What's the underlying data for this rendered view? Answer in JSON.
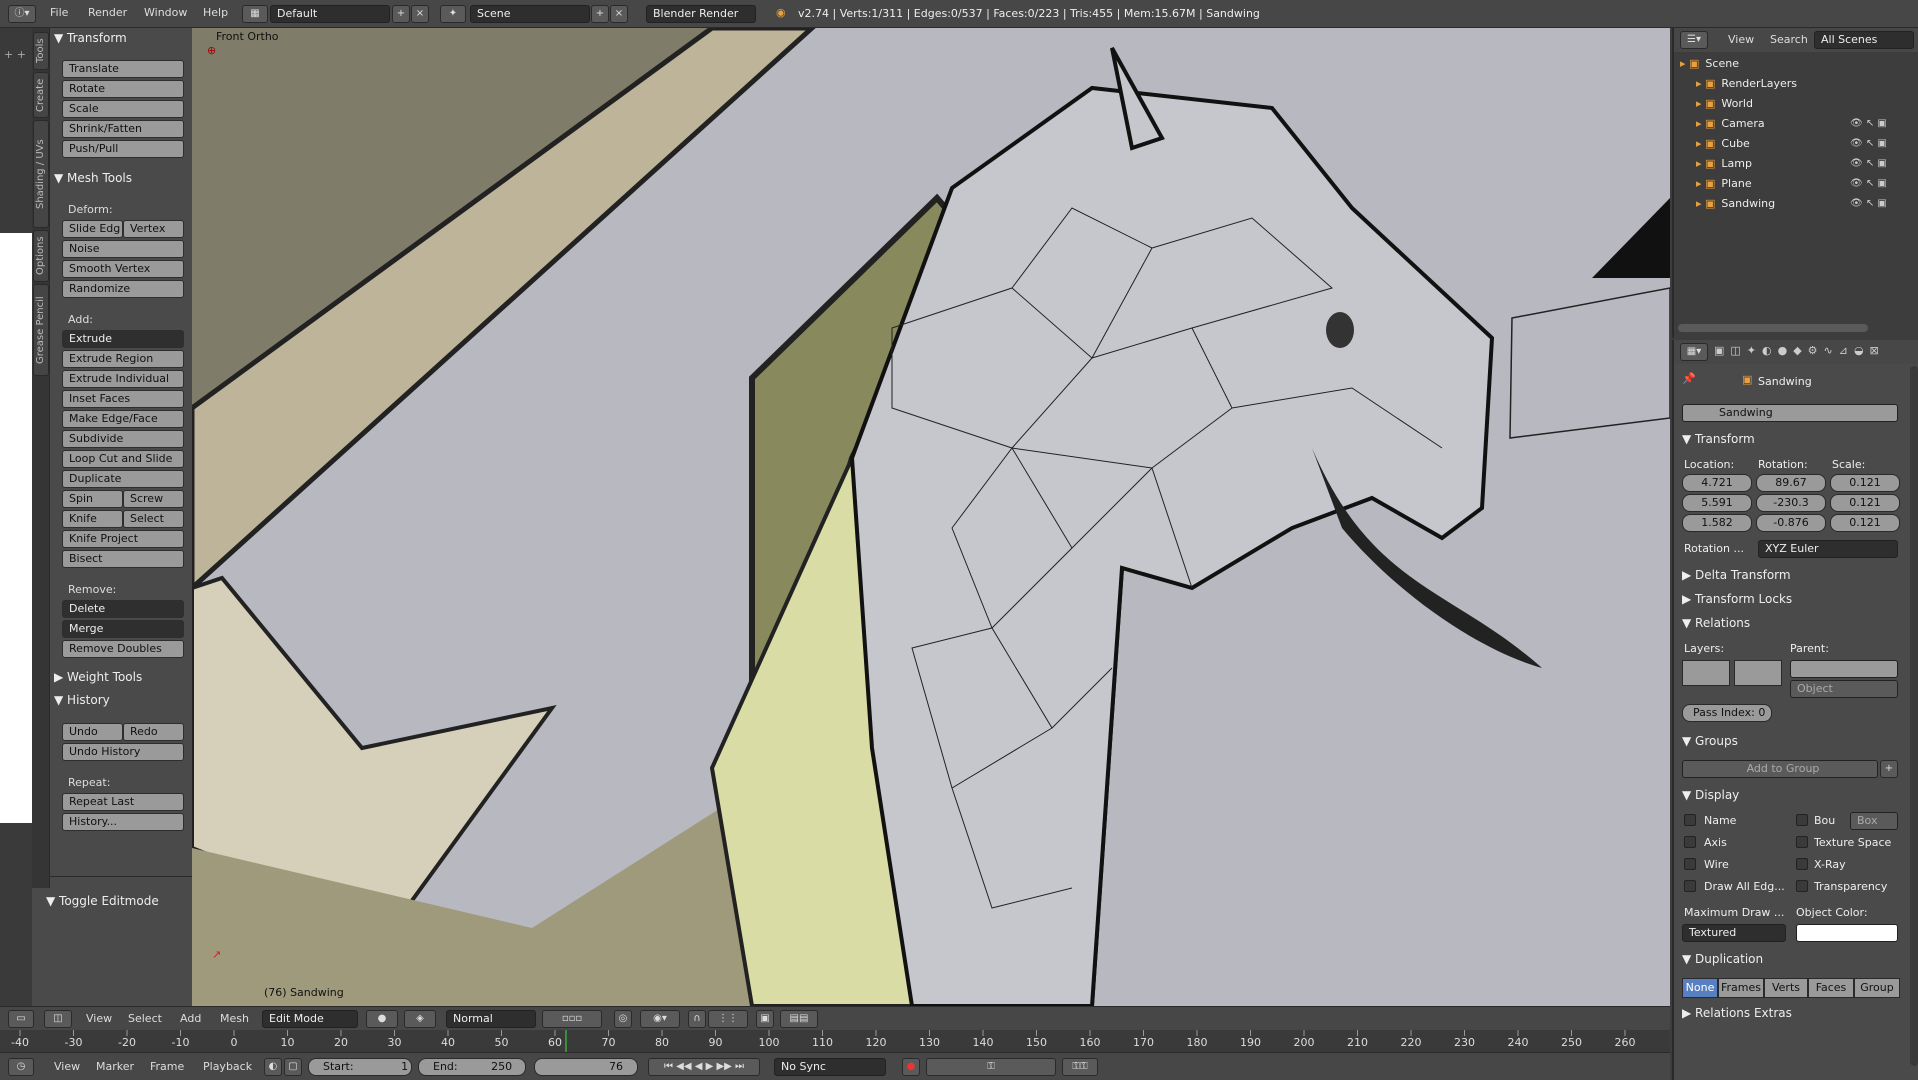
{
  "topbar": {
    "menus": [
      "File",
      "Render",
      "Window",
      "Help"
    ],
    "layout": "Default",
    "scene": "Scene",
    "engine": "Blender Render",
    "stats": "v2.74 | Verts:1/311 | Edges:0/537 | Faces:0/223 | Tris:455 | Mem:15.67M | Sandwing"
  },
  "lefttabs": [
    "Tools",
    "Create",
    "Shading / UVs",
    "Options",
    "Grease Pencil"
  ],
  "tools": {
    "transform_title": "Transform",
    "transform": [
      "Translate",
      "Rotate",
      "Scale",
      "Shrink/Fatten",
      "Push/Pull"
    ],
    "mesh_title": "Mesh Tools",
    "deform_label": "Deform:",
    "slide": "Slide Edg",
    "vertex": "Vertex",
    "noise": "Noise",
    "smooth": "Smooth Vertex",
    "randomize": "Randomize",
    "add_label": "Add:",
    "extrude": "Extrude",
    "add": [
      "Extrude Region",
      "Extrude Individual",
      "Inset Faces",
      "Make Edge/Face",
      "Subdivide",
      "Loop Cut and Slide",
      "Duplicate"
    ],
    "spin": "Spin",
    "screw": "Screw",
    "knife": "Knife",
    "select": "Select",
    "knife_project": "Knife Project",
    "bisect": "Bisect",
    "remove_label": "Remove:",
    "delete": "Delete",
    "merge": "Merge",
    "remove_doubles": "Remove Doubles",
    "weight_title": "Weight Tools",
    "history_title": "History",
    "undo": "Undo",
    "redo": "Redo",
    "undo_history": "Undo History",
    "repeat_label": "Repeat:",
    "repeat_last": "Repeat Last",
    "history_dots": "History...",
    "toggle_editmode": "Toggle Editmode"
  },
  "viewport": {
    "view_name": "Front Ortho",
    "object_label": "(76) Sandwing"
  },
  "vpheader": {
    "menus": [
      "View",
      "Select",
      "Add",
      "Mesh"
    ],
    "mode": "Edit Mode",
    "pivot": "Normal"
  },
  "timeline": {
    "ticks": [
      "-40",
      "-30",
      "-20",
      "-10",
      "0",
      "10",
      "20",
      "30",
      "40",
      "50",
      "60",
      "70",
      "80",
      "90",
      "100",
      "110",
      "120",
      "130",
      "140",
      "150",
      "160",
      "170",
      "180",
      "190",
      "200",
      "210",
      "220",
      "230",
      "240",
      "250",
      "260"
    ]
  },
  "tlheader": {
    "menus": [
      "View",
      "Marker",
      "Frame",
      "Playback"
    ],
    "start_label": "Start:",
    "start": "1",
    "end_label": "End:",
    "end": "250",
    "current": "76",
    "sync": "No Sync"
  },
  "outliner": {
    "menus": [
      "View",
      "Search"
    ],
    "filter": "All Scenes",
    "items": [
      {
        "label": "Scene",
        "indent": 0
      },
      {
        "label": "RenderLayers",
        "indent": 1
      },
      {
        "label": "World",
        "indent": 1
      },
      {
        "label": "Camera",
        "indent": 1
      },
      {
        "label": "Cube",
        "indent": 1
      },
      {
        "label": "Lamp",
        "indent": 1
      },
      {
        "label": "Plane",
        "indent": 1
      },
      {
        "label": "Sandwing",
        "indent": 1
      }
    ]
  },
  "props": {
    "breadcrumb": "Sandwing",
    "object_name": "Sandwing",
    "transform_title": "Transform",
    "location_label": "Location:",
    "rotation_label": "Rotation:",
    "scale_label": "Scale:",
    "location": [
      "4.721",
      "5.591",
      "1.582"
    ],
    "rotation": [
      "89.67",
      "-230.3",
      "-0.876"
    ],
    "scale": [
      "0.121",
      "0.121",
      "0.121"
    ],
    "rotation_mode_label": "Rotation ...",
    "rotation_mode": "XYZ Euler",
    "delta": "Delta Transform",
    "locks": "Transform Locks",
    "relations": "Relations",
    "layers_label": "Layers:",
    "parent_label": "Parent:",
    "parent_type": "Object",
    "pass_index": "Pass Index:",
    "pass_value": "0",
    "groups": "Groups",
    "add_group": "Add to Group",
    "display": "Display",
    "display_left": [
      "Name",
      "Axis",
      "Wire",
      "Draw All Edg..."
    ],
    "display_right": [
      "Bou",
      "Texture Space",
      "X-Ray",
      "Transparency"
    ],
    "bounds_type": "Box",
    "max_draw_label": "Maximum Draw ...",
    "object_color_label": "Object Color:",
    "max_draw": "Textured",
    "duplication": "Duplication",
    "dup_opts": [
      "None",
      "Frames",
      "Verts",
      "Faces",
      "Group"
    ],
    "relations_extras": "Relations Extras"
  }
}
